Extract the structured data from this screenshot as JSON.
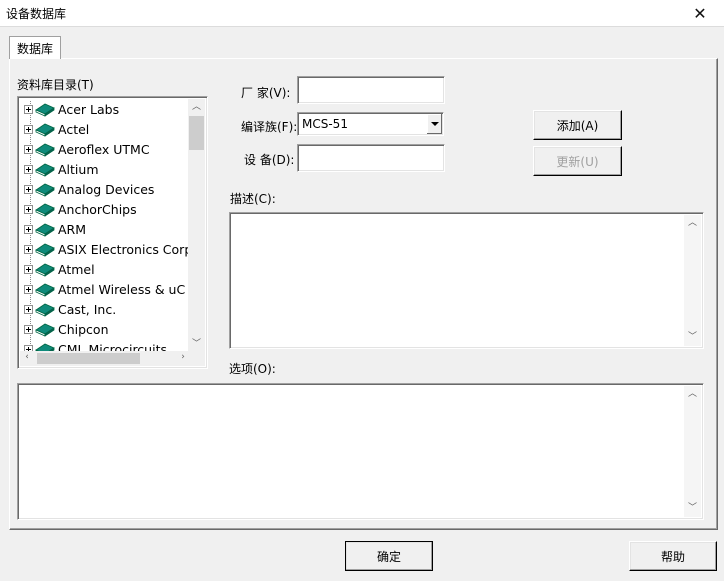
{
  "window": {
    "title": "设备数据库",
    "close_glyph": "✕"
  },
  "tabs": [
    {
      "label": "数据库"
    }
  ],
  "library": {
    "label": "资料库目录(T)",
    "items": [
      "Acer Labs",
      "Actel",
      "Aeroflex UTMC",
      "Altium",
      "Analog Devices",
      "AnchorChips",
      "ARM",
      "ASIX Electronics Corpo",
      "Atmel",
      "Atmel Wireless & uC",
      "Cast, Inc.",
      "Chipcon",
      "CML Microcircuits"
    ]
  },
  "form": {
    "vendor_label": "厂  家(V):",
    "vendor_value": "",
    "family_label": "编译族(F):",
    "family_value": "MCS-51",
    "device_label": "设  备(D):",
    "device_value": "",
    "description_label": "描述(C):",
    "description_value": "",
    "options_label": "选项(O):",
    "options_value": ""
  },
  "buttons": {
    "add": "添加(A)",
    "update": "更新(U)",
    "ok": "确定",
    "help": "帮助"
  },
  "colors": {
    "book_icon": "#0f8a7a"
  }
}
